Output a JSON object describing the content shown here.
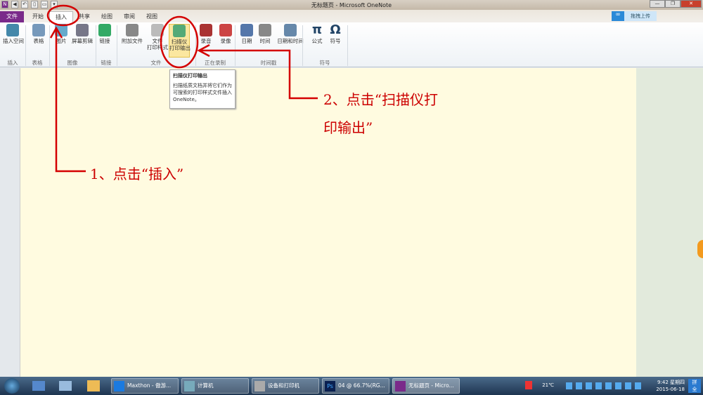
{
  "window": {
    "title": "无标题页 - Microsoft OneNote",
    "controls": [
      "—",
      "❐",
      "✕"
    ]
  },
  "qat": [
    "N",
    "◀",
    "↶",
    "▯",
    "▭",
    "▾"
  ],
  "tabs": [
    "文件",
    "开始",
    "插入",
    "共享",
    "绘图",
    "审阅",
    "视图"
  ],
  "upload": {
    "icon": "cloud-link-icon",
    "label": "拖拽上传"
  },
  "ribbon": {
    "buttons": [
      {
        "label": "插入空间",
        "icon": "insert-space-icon"
      },
      {
        "label": "表格",
        "icon": "table-icon"
      },
      {
        "label": "图片",
        "icon": "picture-icon"
      },
      {
        "label": "屏幕剪辑",
        "icon": "screen-clip-icon"
      },
      {
        "label": "链接",
        "icon": "link-globe-icon"
      },
      {
        "label": "附加文件",
        "icon": "paperclip-icon"
      },
      {
        "label": "文件\n打印样式",
        "icon": "file-printout-icon"
      },
      {
        "label": "扫描仪\n打印输出",
        "icon": "scanner-icon"
      },
      {
        "label": "录音",
        "icon": "microphone-icon"
      },
      {
        "label": "录像",
        "icon": "video-icon"
      },
      {
        "label": "日期",
        "icon": "calendar-icon"
      },
      {
        "label": "时间",
        "icon": "clock-icon"
      },
      {
        "label": "日期和时间",
        "icon": "calendar-clock-icon"
      },
      {
        "label": "公式",
        "icon": "pi-icon",
        "glyph": "π"
      },
      {
        "label": "符号",
        "icon": "omega-icon",
        "glyph": "Ω"
      }
    ],
    "groups": [
      "插入",
      "表格",
      "图像",
      "链接",
      "文件",
      "正在录制",
      "时间戳",
      "符号"
    ]
  },
  "tooltip": {
    "title": "扫描仪打印输出",
    "body": "扫描纸质文档并将它们作为可搜索的打印样式文件插入 OneNote。"
  },
  "annotations": {
    "step1": "1、点击“插入”",
    "step2_line1": "2、点击“扫描仪打",
    "step2_line2": "印输出”",
    "color": "#cc0000"
  },
  "taskbar": {
    "items": [
      "Maxthon - 傲游...",
      "计算机",
      "设备和打印机",
      "04 @ 66.7%(RG...",
      "无标题页 - Micro..."
    ],
    "temperature": "21℃",
    "time": "9:42 星期四",
    "date": "2015-06-18",
    "ime": "拼\n全"
  }
}
